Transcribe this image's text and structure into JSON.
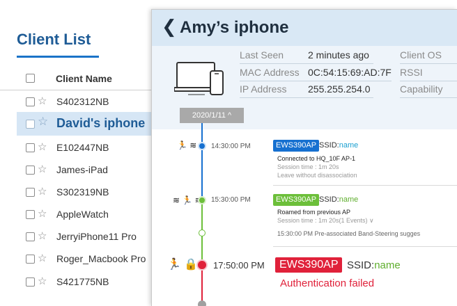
{
  "client_list": {
    "title": "Client List",
    "header_label": "Client Name",
    "items": [
      {
        "name": "S402312NB"
      },
      {
        "name": "David's iphone",
        "selected": true
      },
      {
        "name": "E102447NB"
      },
      {
        "name": "James-iPad"
      },
      {
        "name": "S302319NB"
      },
      {
        "name": "AppleWatch"
      },
      {
        "name": "JerryiPhone11 Pro"
      },
      {
        "name": "Roger_Macbook Pro"
      },
      {
        "name": "S421775NB"
      }
    ]
  },
  "detail": {
    "title": "Amy’s iphone",
    "info": {
      "last_seen_label": "Last Seen",
      "last_seen_value": "2 minutes ago",
      "client_os_label": "Client OS",
      "mac_label": "MAC Address",
      "mac_value": "0C:54:15:69:AD:7F",
      "rssi_label": "RSSI",
      "ip_label": "IP Address",
      "ip_value": "255.255.254.0",
      "capability_label": "Capability"
    },
    "date_chip": "2020/1/11 ^",
    "events": [
      {
        "time": "14:30:00 PM",
        "icons": "🏃 ≋",
        "ap": "EWS390AP",
        "ssid_label": "SSID:",
        "ssid_value": "name",
        "lines": [
          "Connected to HQ_10F AP-1",
          "Session time : 1m 20s",
          "Leave without disassociation"
        ]
      },
      {
        "time": "15:30:00 PM",
        "icons": "≋ 🏃 ≋",
        "ap": "EWS390AP",
        "ssid_label": "SSID:",
        "ssid_value": "name",
        "lines": [
          "Roamed from previous AP",
          "Session time : 1m 20s(1 Events) ∨"
        ],
        "sub_event": "15:30:00 PM   Pre-associated Band-Steering sugges"
      },
      {
        "time": "17:50:00 PM",
        "icons": "🏃 🔒",
        "ap": "EWS390AP",
        "ssid_label": "SSID:",
        "ssid_value": "name",
        "message": "Authentication failed"
      }
    ]
  },
  "colors": {
    "accent_blue": "#1a73c8",
    "ap_blue": "#1670d0",
    "ap_green": "#6cbf3a",
    "ap_red": "#e0213a",
    "ssid_teal": "#1a9fd0",
    "ssid_green": "#5fae2e",
    "ssid_red_text": "#e0213a",
    "header_bg": "#d9e8f5"
  }
}
